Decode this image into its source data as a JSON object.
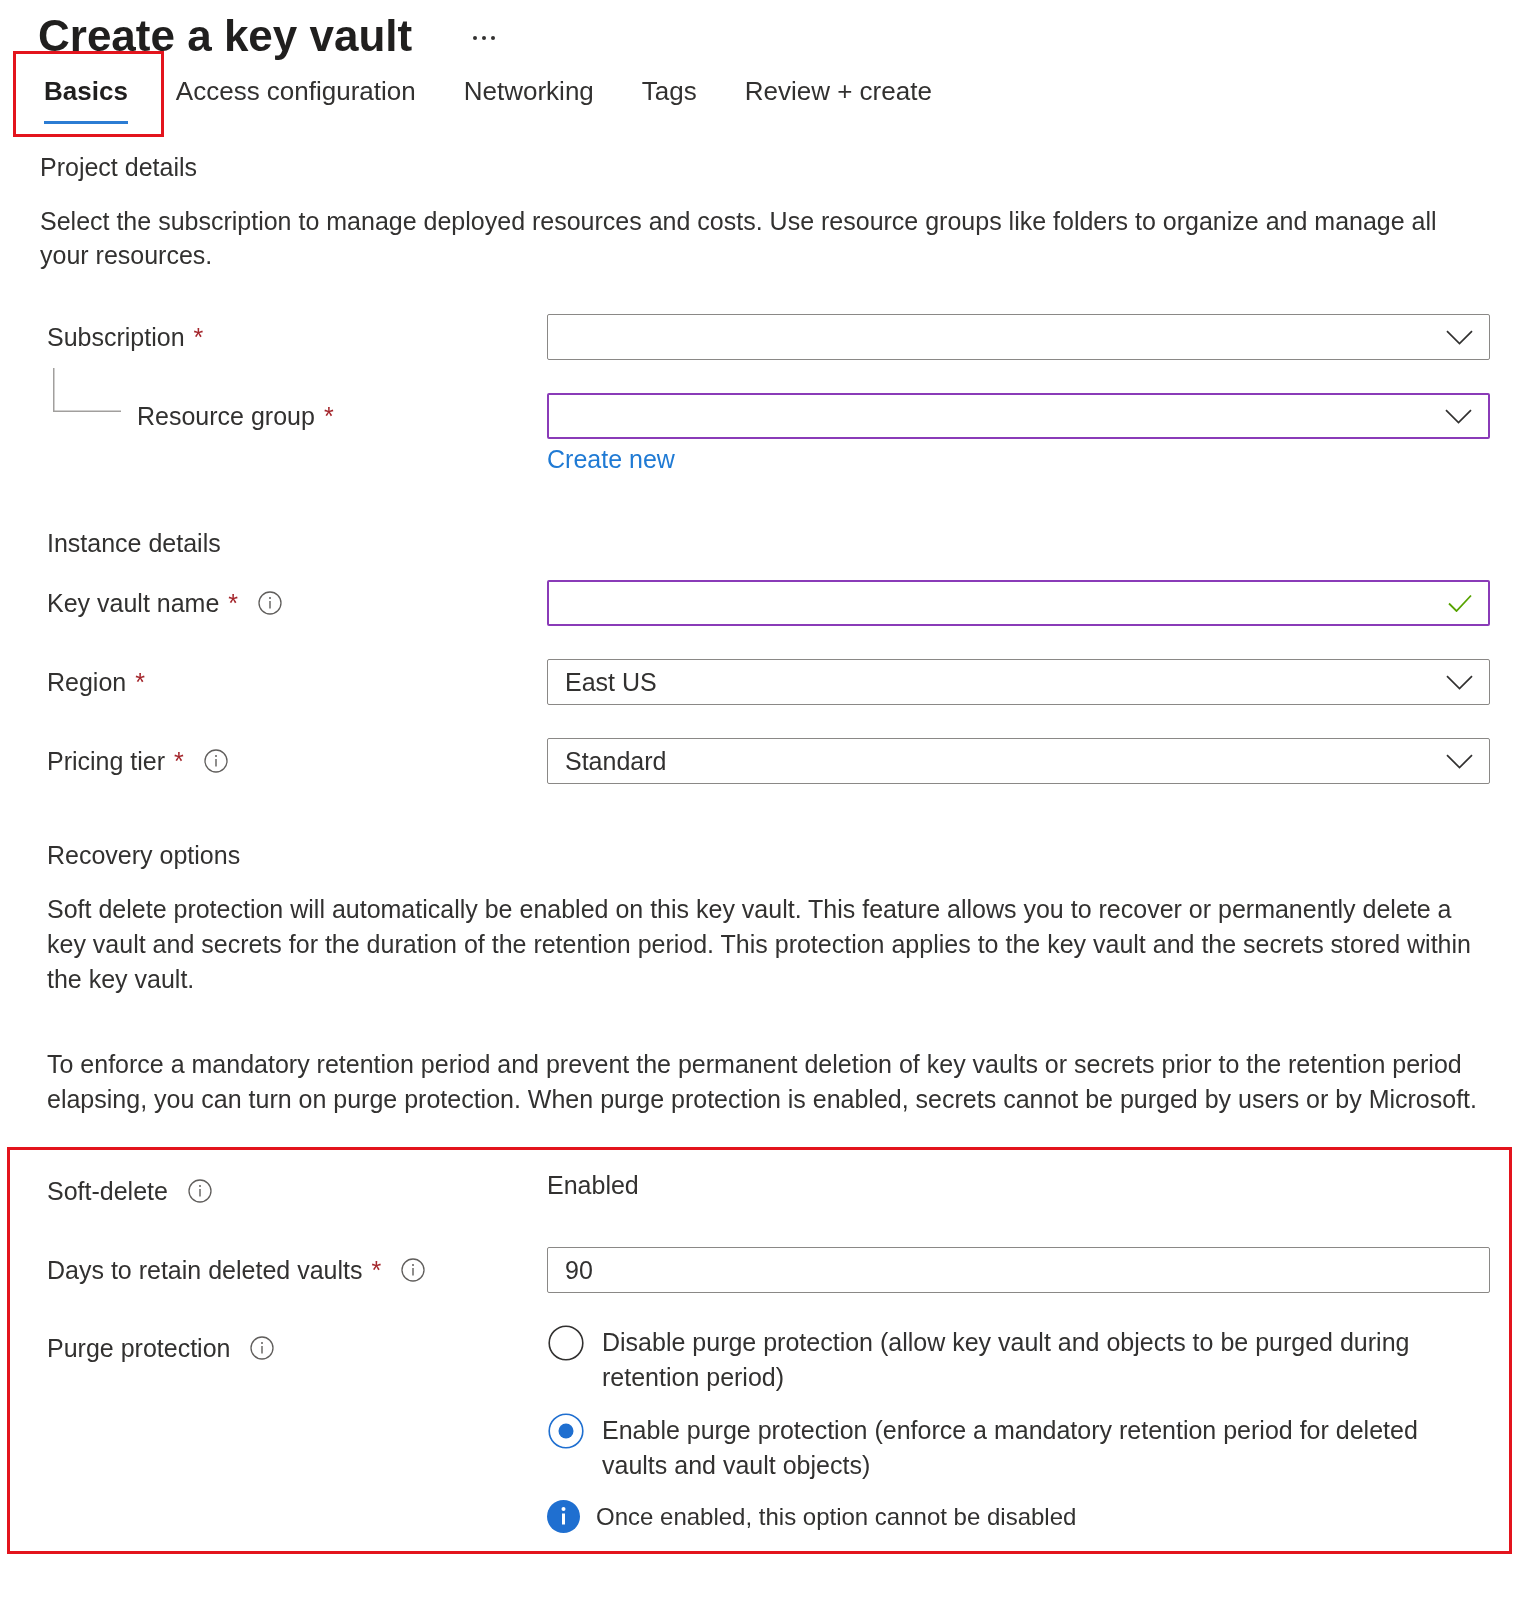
{
  "header": {
    "title": "Create a key vault"
  },
  "tabs": [
    {
      "label": "Basics",
      "selected": true,
      "highlighted": true
    },
    {
      "label": "Access configuration",
      "selected": false,
      "highlighted": false
    },
    {
      "label": "Networking",
      "selected": false,
      "highlighted": false
    },
    {
      "label": "Tags",
      "selected": false,
      "highlighted": false
    },
    {
      "label": "Review + create",
      "selected": false,
      "highlighted": false
    }
  ],
  "project_details": {
    "heading": "Project details",
    "description": "Select the subscription to manage deployed resources and costs. Use resource groups like folders to organize and manage all your resources.",
    "fields": [
      {
        "kind": "dropdown",
        "label": "Subscription",
        "required_mark": "*",
        "focused": false,
        "children": [
          {
            "kind": "dropdown",
            "label": "Resource group",
            "required_mark": "*",
            "focused": true,
            "link": "Create new"
          }
        ]
      }
    ]
  },
  "instance_details": {
    "heading": "Instance details",
    "fields": [
      {
        "kind": "text",
        "label": "Key vault name",
        "required_mark": "*",
        "info": true,
        "focused": true,
        "valid": true
      },
      {
        "kind": "dropdown",
        "label": "Region",
        "required_mark": "*",
        "focused": false,
        "value": "East US"
      },
      {
        "kind": "dropdown",
        "label": "Pricing tier",
        "required_mark": "*",
        "info": true,
        "focused": false,
        "value": "Standard"
      }
    ]
  },
  "recovery_options": {
    "heading": "Recovery options",
    "paragraphs": [
      "Soft delete protection will automatically be enabled on this key vault. This feature allows you to recover or permanently delete a key vault and secrets for the duration of the retention period. This protection applies to the key vault and the secrets stored within the key vault.",
      "To enforce a mandatory retention period and prevent the permanent deletion of key vaults or secrets prior to the retention period elapsing, you can turn on purge protection. When purge protection is enabled, secrets cannot be purged by users or by Microsoft."
    ],
    "settings": {
      "highlighted": true,
      "fields": [
        {
          "kind": "static",
          "label": "Soft-delete",
          "info": true,
          "value": "Enabled"
        },
        {
          "kind": "text",
          "label": "Days to retain deleted vaults",
          "required_mark": "*",
          "info": true,
          "focused": false,
          "value": "90"
        },
        {
          "kind": "radio",
          "label": "Purge protection",
          "info": true,
          "options": [
            {
              "label": "Disable purge protection (allow key vault and objects to be purged during retention period)",
              "selected": false
            },
            {
              "label": "Enable purge protection (enforce a mandatory retention period for deleted vaults and vault objects)",
              "selected": true
            }
          ],
          "note": "Once enabled, this option cannot be disabled"
        }
      ]
    }
  }
}
